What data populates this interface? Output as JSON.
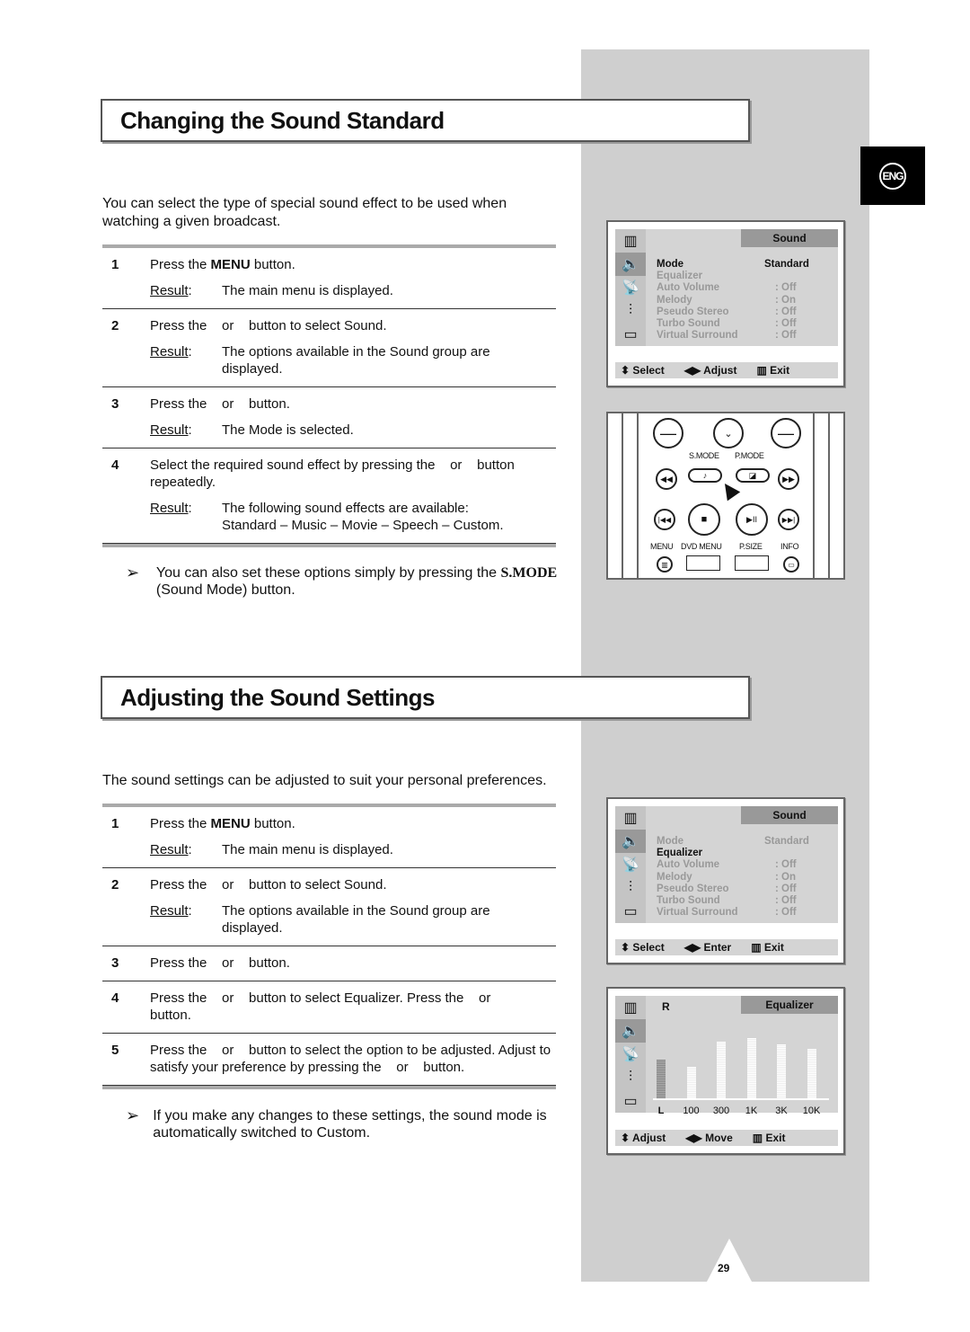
{
  "side_tab": {
    "label": "ENG"
  },
  "page_number": "29",
  "section1": {
    "title": "Changing the Sound Standard",
    "intro": "You can select the type of special sound effect to be used when watching a given broadcast.",
    "steps": [
      {
        "num": "1",
        "text_a": "Press the ",
        "bold": "MENU",
        "text_b": " button.",
        "result": "The main menu is displayed."
      },
      {
        "num": "2",
        "text": "Press the    or    button to select Sound.",
        "result": "The options available in the Sound group are displayed."
      },
      {
        "num": "3",
        "text": "Press the    or    button.",
        "result": "The Mode is selected."
      },
      {
        "num": "4",
        "text": "Select the required sound effect by pressing the    or    button repeatedly.",
        "result": "The following sound effects are available:",
        "result2": "Standard  – Music  – Movie  – Speech  – Custom."
      }
    ],
    "result_label": "Result",
    "note_a": "You can also set these options simply by pressing the ",
    "note_bold": "S.MODE",
    "note_b": " (Sound Mode) button."
  },
  "section2": {
    "title": "Adjusting the Sound Settings",
    "intro": "The sound settings can be adjusted to suit your personal preferences.",
    "steps": [
      {
        "num": "1",
        "text_a": "Press the ",
        "bold": "MENU",
        "text_b": " button.",
        "result": "The main menu is displayed."
      },
      {
        "num": "2",
        "text": "Press the    or    button to select Sound.",
        "result": "The options available in the Sound group are displayed."
      },
      {
        "num": "3",
        "text": "Press the    or    button."
      },
      {
        "num": "4",
        "text": "Press the    or    button to select Equalizer. Press the    or    button."
      },
      {
        "num": "5",
        "text": "Press the    or    button to select the option to be adjusted. Adjust to satisfy your preference by pressing the    or    button."
      }
    ],
    "result_label": "Result",
    "note": "If you make any changes to these settings, the sound mode is automatically switched to Custom."
  },
  "screen1": {
    "header": "Sound",
    "items": [
      {
        "label": "Mode",
        "value": "Standard"
      },
      {
        "label": "Equalizer",
        "value": ""
      },
      {
        "label": "Auto Volume",
        "value": ": Off"
      },
      {
        "label": "Melody",
        "value": ": On"
      },
      {
        "label": "Pseudo Stereo",
        "value": ": Off"
      },
      {
        "label": "Turbo Sound",
        "value": ": Off"
      },
      {
        "label": "Virtual Surround",
        "value": ": Off"
      }
    ],
    "footer": {
      "select": "Select",
      "adjust": "Adjust",
      "exit": "Exit"
    }
  },
  "remote": {
    "labels": {
      "smode": "S.MODE",
      "pmode": "P.MODE",
      "menu": "MENU",
      "dvd_menu": "DVD MENU",
      "psize": "P.SIZE",
      "info": "INFO"
    }
  },
  "screen2": {
    "header": "Sound",
    "items": [
      {
        "label": "Mode",
        "value": "Standard"
      },
      {
        "label": "Equalizer",
        "value": ""
      },
      {
        "label": "Auto Volume",
        "value": ": Off"
      },
      {
        "label": "Melody",
        "value": ": On"
      },
      {
        "label": "Pseudo Stereo",
        "value": ": Off"
      },
      {
        "label": "Turbo Sound",
        "value": ": Off"
      },
      {
        "label": "Virtual Surround",
        "value": ": Off"
      }
    ],
    "footer": {
      "select": "Select",
      "enter": "Enter",
      "exit": "Exit"
    }
  },
  "screen3": {
    "header": "Equalizer",
    "r_label": "R",
    "bands": [
      {
        "label": "L",
        "level": 57
      },
      {
        "label": "100",
        "level": 47
      },
      {
        "label": "300",
        "level": 84
      },
      {
        "label": "1K",
        "level": 90
      },
      {
        "label": "3K",
        "level": 80
      },
      {
        "label": "10K",
        "level": 73
      }
    ],
    "footer": {
      "adjust": "Adjust",
      "move": "Move",
      "exit": "Exit"
    }
  }
}
